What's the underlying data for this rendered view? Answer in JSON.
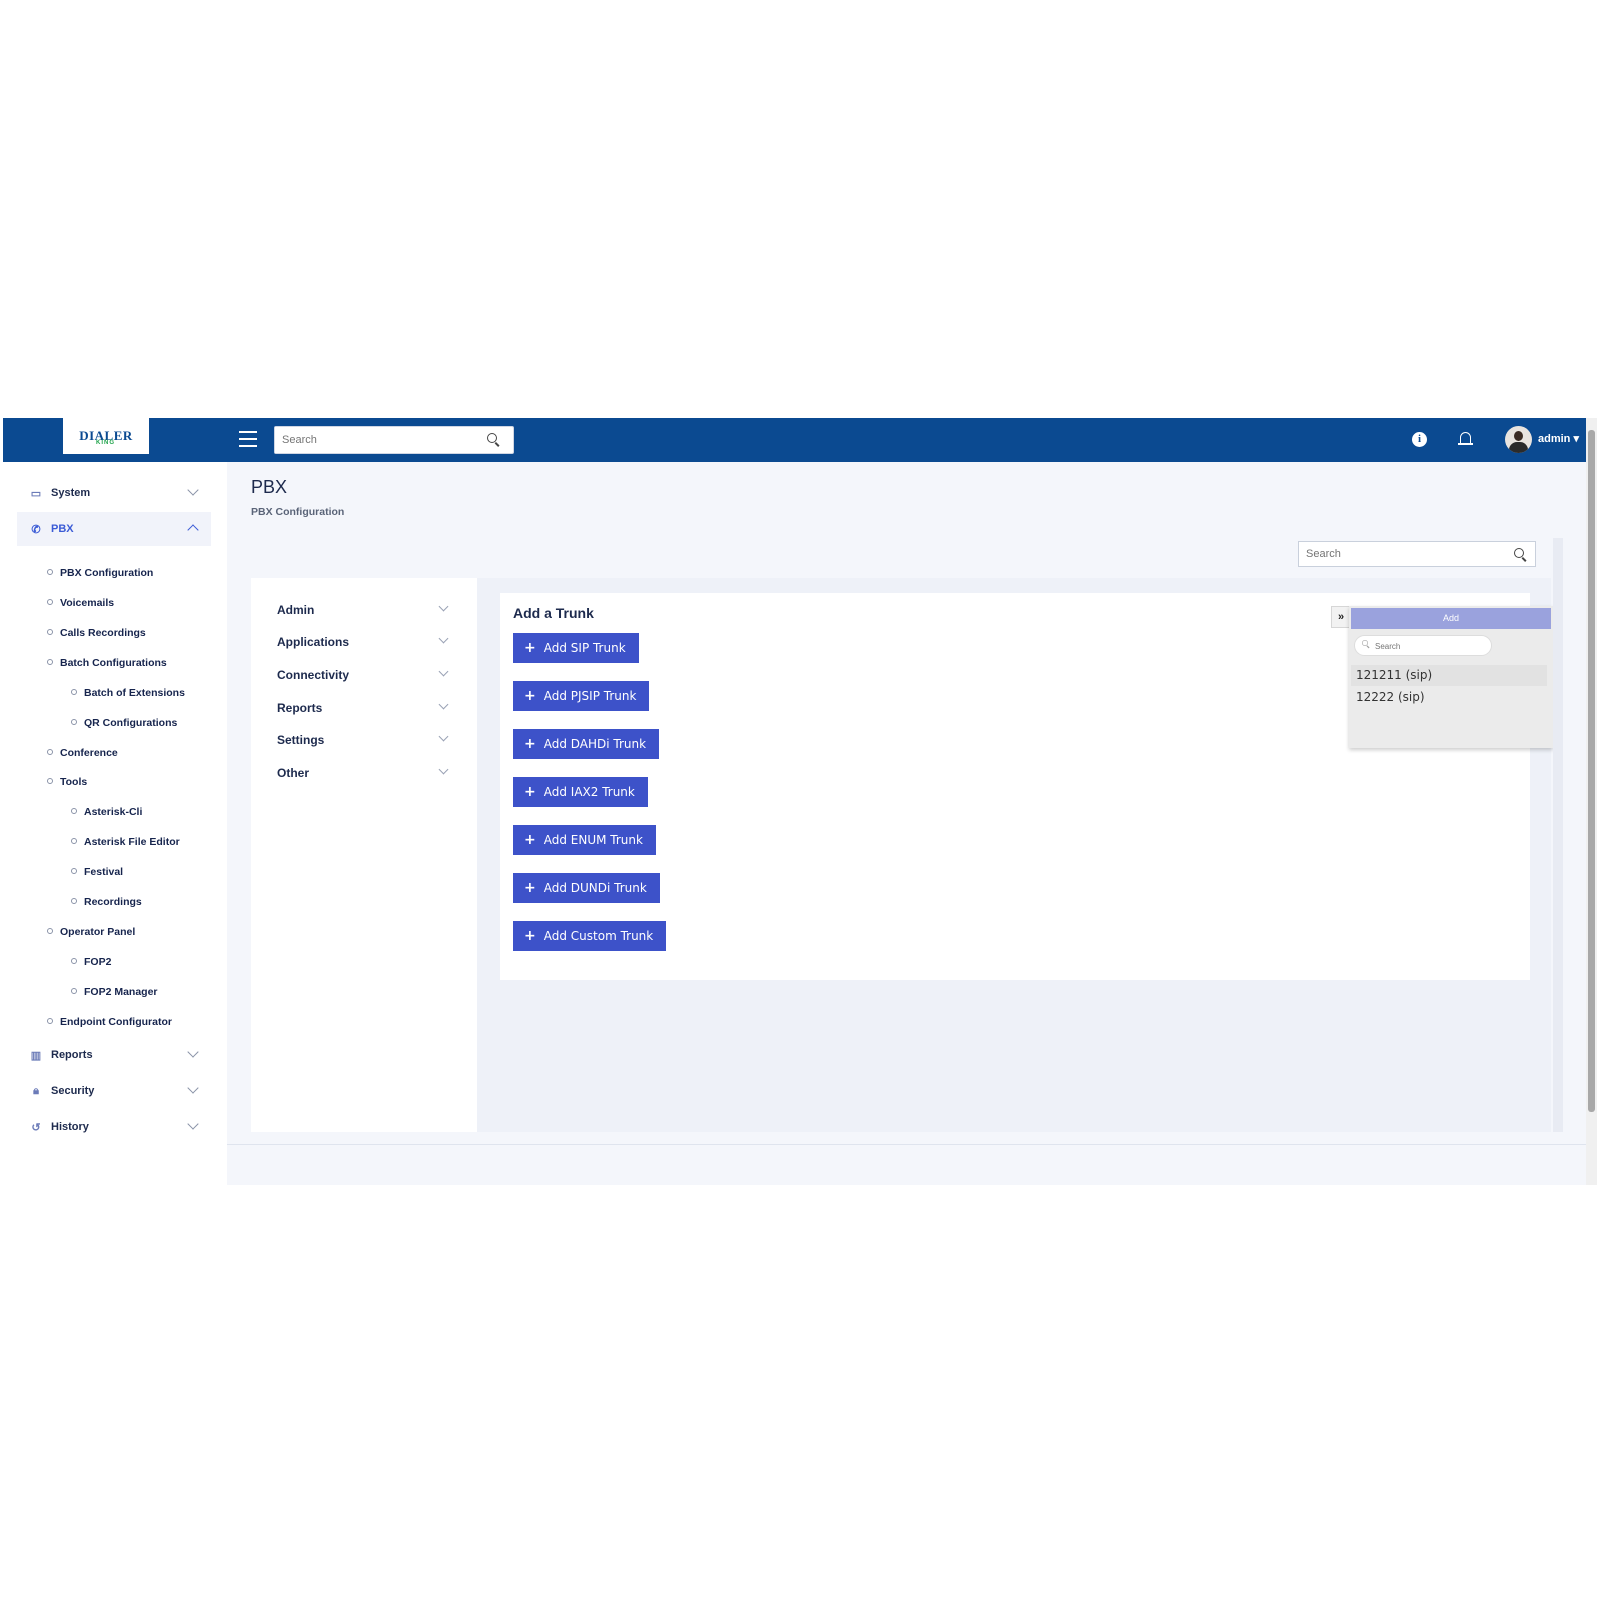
{
  "topbar": {
    "logo_text": "DIALER",
    "logo_sub": "KING",
    "search_placeholder": "Search",
    "user_name": "admin"
  },
  "sidebar": {
    "items": [
      {
        "label": "System",
        "icon": "laptop-icon"
      },
      {
        "label": "PBX",
        "icon": "phone-icon"
      },
      {
        "label": "Reports",
        "icon": "bar-chart-icon"
      },
      {
        "label": "Security",
        "icon": "lock-icon"
      },
      {
        "label": "History",
        "icon": "history-icon"
      }
    ],
    "pbx_children": [
      "PBX Configuration",
      "Voicemails",
      "Calls Recordings",
      "Batch Configurations",
      "Batch of Extensions",
      "QR Configurations",
      "Conference",
      "Tools",
      "Asterisk-Cli",
      "Asterisk File Editor",
      "Festival",
      "Recordings",
      "Operator Panel",
      "FOP2",
      "FOP2 Manager",
      "Endpoint Configurator"
    ]
  },
  "page": {
    "title": "PBX",
    "subtitle": "PBX Configuration",
    "search_placeholder": "Search"
  },
  "categories": [
    "Admin",
    "Applications",
    "Connectivity",
    "Reports",
    "Settings",
    "Other"
  ],
  "trunk_card": {
    "title": "Add a Trunk",
    "buttons": [
      "Add SIP Trunk",
      "Add PJSIP Trunk",
      "Add DAHDi Trunk",
      "Add IAX2 Trunk",
      "Add ENUM Trunk",
      "Add DUNDi Trunk",
      "Add Custom Trunk"
    ]
  },
  "float_panel": {
    "toggle_label": "»",
    "add_label": "Add",
    "search_placeholder": "Search",
    "items": [
      "121211 (sip)",
      "12222 (sip)"
    ]
  },
  "colors": {
    "topbar": "#0b4a91",
    "button": "#3d52c9",
    "active_nav": "#3b5bd6"
  }
}
